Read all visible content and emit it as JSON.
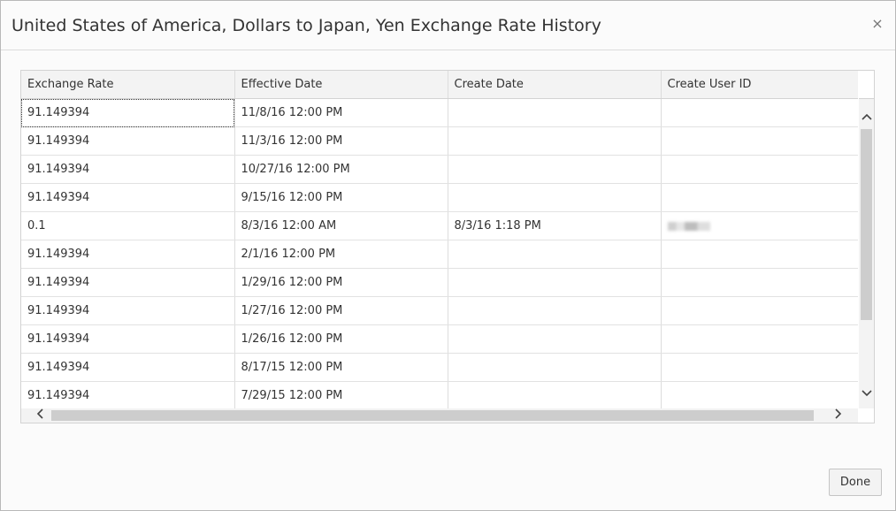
{
  "dialog": {
    "title": "United States of America, Dollars to Japan, Yen Exchange Rate History",
    "close_label": "×",
    "done_label": "Done"
  },
  "table": {
    "columns": [
      "Exchange Rate",
      "Effective Date",
      "Create Date",
      "Create User ID"
    ],
    "rows": [
      {
        "rate": "91.149394",
        "effective": "11/8/16 12:00 PM",
        "created": "",
        "user": ""
      },
      {
        "rate": "91.149394",
        "effective": "11/3/16 12:00 PM",
        "created": "",
        "user": ""
      },
      {
        "rate": "91.149394",
        "effective": "10/27/16 12:00 PM",
        "created": "",
        "user": ""
      },
      {
        "rate": "91.149394",
        "effective": "9/15/16 12:00 PM",
        "created": "",
        "user": ""
      },
      {
        "rate": "0.1",
        "effective": "8/3/16 12:00 AM",
        "created": "8/3/16 1:18 PM",
        "user": ""
      },
      {
        "rate": "91.149394",
        "effective": "2/1/16 12:00 PM",
        "created": "",
        "user": ""
      },
      {
        "rate": "91.149394",
        "effective": "1/29/16 12:00 PM",
        "created": "",
        "user": ""
      },
      {
        "rate": "91.149394",
        "effective": "1/27/16 12:00 PM",
        "created": "",
        "user": ""
      },
      {
        "rate": "91.149394",
        "effective": "1/26/16 12:00 PM",
        "created": "",
        "user": ""
      },
      {
        "rate": "91.149394",
        "effective": "8/17/15 12:00 PM",
        "created": "",
        "user": ""
      },
      {
        "rate": "91.149394",
        "effective": "7/29/15 12:00 PM",
        "created": "",
        "user": ""
      }
    ]
  },
  "icons": {
    "close": "close-icon",
    "scroll_up": "chevron-up-icon",
    "scroll_down": "chevron-down-icon",
    "scroll_left": "chevron-left-icon",
    "scroll_right": "chevron-right-icon"
  }
}
